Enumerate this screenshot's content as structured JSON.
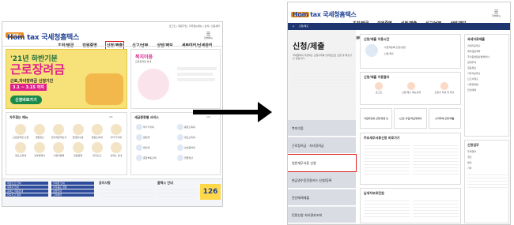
{
  "left": {
    "header": {
      "badge": "SN플렉스",
      "logo": "Hom tax 국세청홈택스",
      "top_links": "로그인 | 회원가입 | 자주찾는메뉴 | 검색 | 인증센터",
      "nav": [
        "조회/발급",
        "민원증명",
        "신청/제출",
        "신고/납부",
        "상담/제보",
        "세무대리/납세관리"
      ],
      "all_menu": "전체메뉴"
    },
    "banner": {
      "year_tag": "'21년 하반기분",
      "title": "근로장려금",
      "subtitle": "근로,자녀장려금 신청기간",
      "period": "3.1 ~ 3.15 까지",
      "button": "신청바로가기"
    },
    "notice": {
      "title": "복지이음",
      "subtitle": "근로장려금 안내"
    },
    "faq": {
      "title": "자주찾는 메뉴",
      "pager": "1/1",
      "items": [
        "근로장려금 신청",
        "연말정산",
        "전자세금계산서",
        "현금영수증",
        "종합소득세",
        "부가가치세",
        "양도소득세",
        "납부증명서",
        "사업자등록",
        "민원증명",
        "전자신고",
        "홈택스 안내"
      ]
    },
    "services": {
      "title": "세금종류별 서비스",
      "pager": "1/2",
      "items": [
        "부가가치세",
        "종합소득세",
        "원천세",
        "양도소득세",
        "법인세",
        "상속증여세",
        "종합부동산세",
        "연말정산"
      ]
    },
    "bottom": {
      "links": [
        "세금신고 안내",
        "세무서 안내",
        "홈택스 이용안내",
        "전자신고 결과",
        "국세청 안내",
        "자주묻는 질문",
        "상담안내",
        "고객센터"
      ],
      "notice_title": "공지사항",
      "event_title": "홈택스 안내",
      "callcenter": "126"
    }
  },
  "right": {
    "header": {
      "badge": "SN플렉스",
      "logo": "Hom tax 국세청홈택스",
      "nav": [
        "조회/발급",
        "민원증명",
        "신청/제출",
        "신고/납부",
        "상담/제보",
        "세무대리/납세관리"
      ],
      "all_menu": "전체메뉴",
      "breadcrumb": "신청/제출"
    },
    "page_title": "신청/제출",
    "description": "국세청에서 주관하는 신청사무를 인터넷으로 신청 및 제출할 수 있습니다.",
    "side_menu": [
      "복지이음",
      "근로장려금 · 자녀장려금",
      "일반세무서류 신청",
      "현금영수증전용카드 신청/등록",
      "전산매체제출",
      "민원신청 처리결과조회"
    ],
    "guide_box": {
      "title": "신청/제출 이용시간",
      "rows": [
        "· 사업자등록 신청/정정",
        "· 신청/제출"
      ]
    },
    "usage": {
      "title": "신청/제출 이용절차",
      "steps": [
        "로그인",
        "신청/제출 메뉴선택",
        "신청서 작성 및 제출"
      ]
    },
    "quick_buttons": [
      "사업자등록 신청/정정 등",
      "(근로·사업)지급명세서",
      "소비자에 신청/제출"
    ],
    "main_box_title": "주요세무서류신청 바로가기",
    "tax_box_title": "납세자보호민원",
    "right_col": {
      "title": "과세자료제출",
      "items": [
        "과세자료제출",
        "해외금융계좌",
        "주식등변동상황명세서",
        "임대주택",
        "금융정보",
        "기타자료제출",
        "신고서제출",
        "사업장현황",
        "전산매체"
      ],
      "lower_title": "신청업무",
      "lower_items": [
        "주택청약",
        "개인",
        "법인",
        "기타"
      ]
    }
  }
}
